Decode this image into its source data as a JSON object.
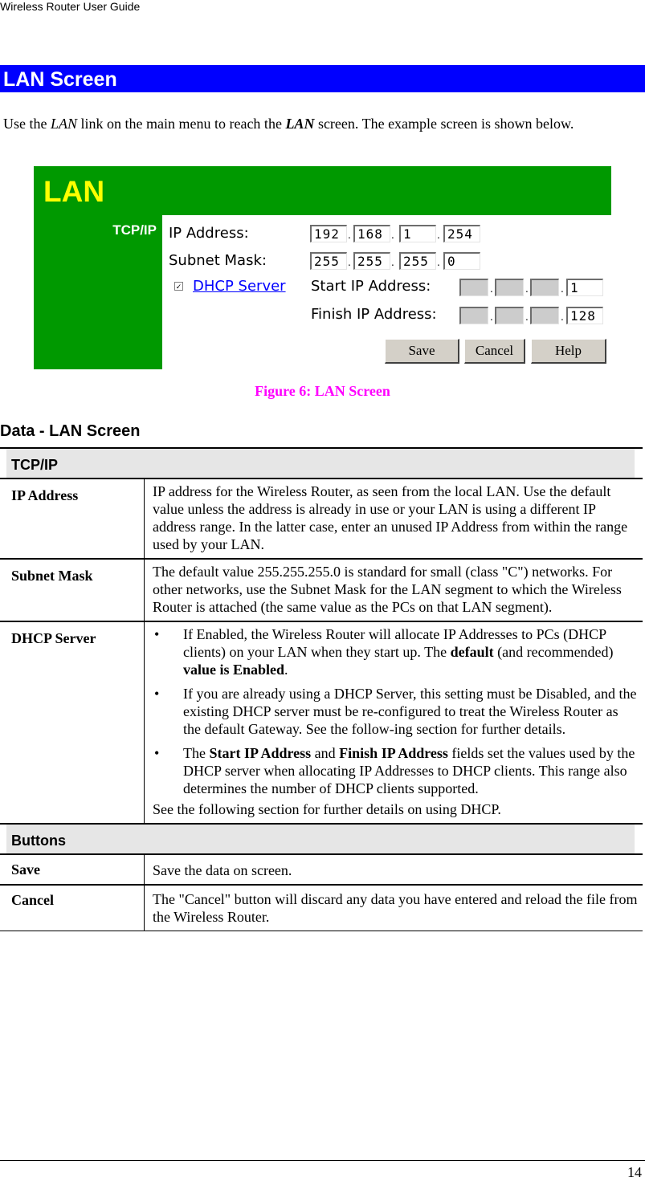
{
  "header": {
    "running_title": "Wireless Router User Guide"
  },
  "section": {
    "title": "LAN Screen"
  },
  "intro": {
    "part1": "Use the ",
    "link_word": "LAN",
    "part2": " link on the main menu to reach the ",
    "screen_word": "LAN",
    "part3": " screen. The example screen is shown below."
  },
  "figure": {
    "title": "LAN",
    "section_label": "TCP/IP",
    "ip_address_label": "IP Address:",
    "ip_address": [
      "192",
      "168",
      "1",
      "254"
    ],
    "subnet_mask_label": "Subnet Mask:",
    "subnet_mask": [
      "255",
      "255",
      "255",
      "0"
    ],
    "dhcp_checkbox_checked": true,
    "dhcp_checkbox_glyph": "✓",
    "dhcp_link": "DHCP Server",
    "start_ip_label": "Start IP Address:",
    "start_ip": [
      "",
      "",
      "",
      "1"
    ],
    "finish_ip_label": "Finish IP Address:",
    "finish_ip": [
      "",
      "",
      "",
      "128"
    ],
    "dot": ".",
    "buttons": {
      "save": "Save",
      "cancel": "Cancel",
      "help": "Help"
    },
    "colors": {
      "background": "#009900",
      "title": "#ffff00",
      "panel": "#ffffff",
      "link": "#0000ff"
    }
  },
  "caption": "Figure 6: LAN Screen",
  "data_heading": "Data - LAN Screen",
  "table": {
    "group_tcpip": "TCP/IP",
    "ip_address": {
      "label": "IP Address",
      "text": "IP address for the Wireless Router, as seen from the local LAN. Use the default value unless the address is already in use or your LAN is using a different IP address range. In the latter case, enter an unused IP Address from within the range used by your LAN."
    },
    "subnet_mask": {
      "label": "Subnet Mask",
      "text": "The default value 255.255.255.0 is standard for small (class \"C\") networks. For other networks, use the Subnet Mask for the LAN segment to which the Wireless Router is attached (the same value as the PCs on that LAN segment)."
    },
    "dhcp_server": {
      "label": "DHCP Server",
      "bullet_glyph": "•",
      "b1_a": "If Enabled, the Wireless Router will allocate IP Addresses to PCs (DHCP clients) on your LAN when they start up. The ",
      "b1_bold1": "default",
      "b1_b": " (and recommended) ",
      "b1_bold2": "value is Enabled",
      "b1_c": ".",
      "b2": "If you are already using a DHCP Server, this setting must be Disabled, and the existing DHCP server must be re-configured to treat the Wireless Router as the default Gateway. See the follow-ing section for further details.",
      "b3_a": "The ",
      "b3_bold1": "Start IP Address",
      "b3_b": " and ",
      "b3_bold2": "Finish IP Address",
      "b3_c": " fields set the values used by the DHCP server when allocating IP Addresses to DHCP clients. This range also determines the number of DHCP clients supported.",
      "note": "See the following section for further details on using DHCP."
    },
    "group_buttons": "Buttons",
    "save": {
      "label": "Save",
      "text": "Save the data on screen."
    },
    "cancel": {
      "label": "Cancel",
      "text": "The \"Cancel\" button will discard any data you have entered and reload the file from the Wireless Router."
    }
  },
  "footer": {
    "page_number": "14"
  },
  "colors": {
    "banner": "#0000ff",
    "caption": "#ff00ff",
    "group_header_bg": "#e6e6e6"
  }
}
